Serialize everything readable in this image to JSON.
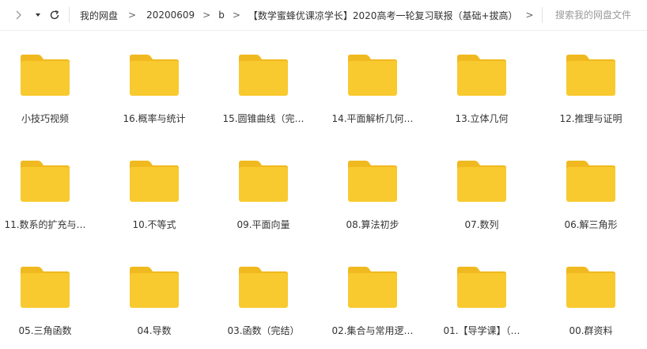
{
  "toolbar": {
    "back_icon": "chevron-left-icon",
    "dropdown_icon": "caret-down-icon",
    "refresh_icon": "refresh-icon"
  },
  "breadcrumb": {
    "items": [
      "我的网盘",
      "20200609",
      "b",
      "【数学蜜蜂优课凉学长】2020高考一轮复习联报（基础+拔高）"
    ],
    "separator": ">"
  },
  "search": {
    "placeholder": "搜索我的网盘文件"
  },
  "colors": {
    "folder_body": "#f8ca2f",
    "folder_tab": "#f0b91f",
    "divider": "#e2e2e2"
  },
  "folders": [
    {
      "name": "小技巧视频"
    },
    {
      "name": "16.概率与统计"
    },
    {
      "name": "15.圆锥曲线（完…"
    },
    {
      "name": "14.平面解析几何…"
    },
    {
      "name": "13.立体几何"
    },
    {
      "name": "12.推理与证明"
    },
    {
      "name": "11.数系的扩充与…"
    },
    {
      "name": "10.不等式"
    },
    {
      "name": "09.平面向量"
    },
    {
      "name": "08.算法初步"
    },
    {
      "name": "07.数列"
    },
    {
      "name": "06.解三角形"
    },
    {
      "name": "05.三角函数"
    },
    {
      "name": "04.导数"
    },
    {
      "name": "03.函数（完结）"
    },
    {
      "name": "02.集合与常用逻…"
    },
    {
      "name": "01.【导学课】（…"
    },
    {
      "name": "00.群资料"
    }
  ]
}
